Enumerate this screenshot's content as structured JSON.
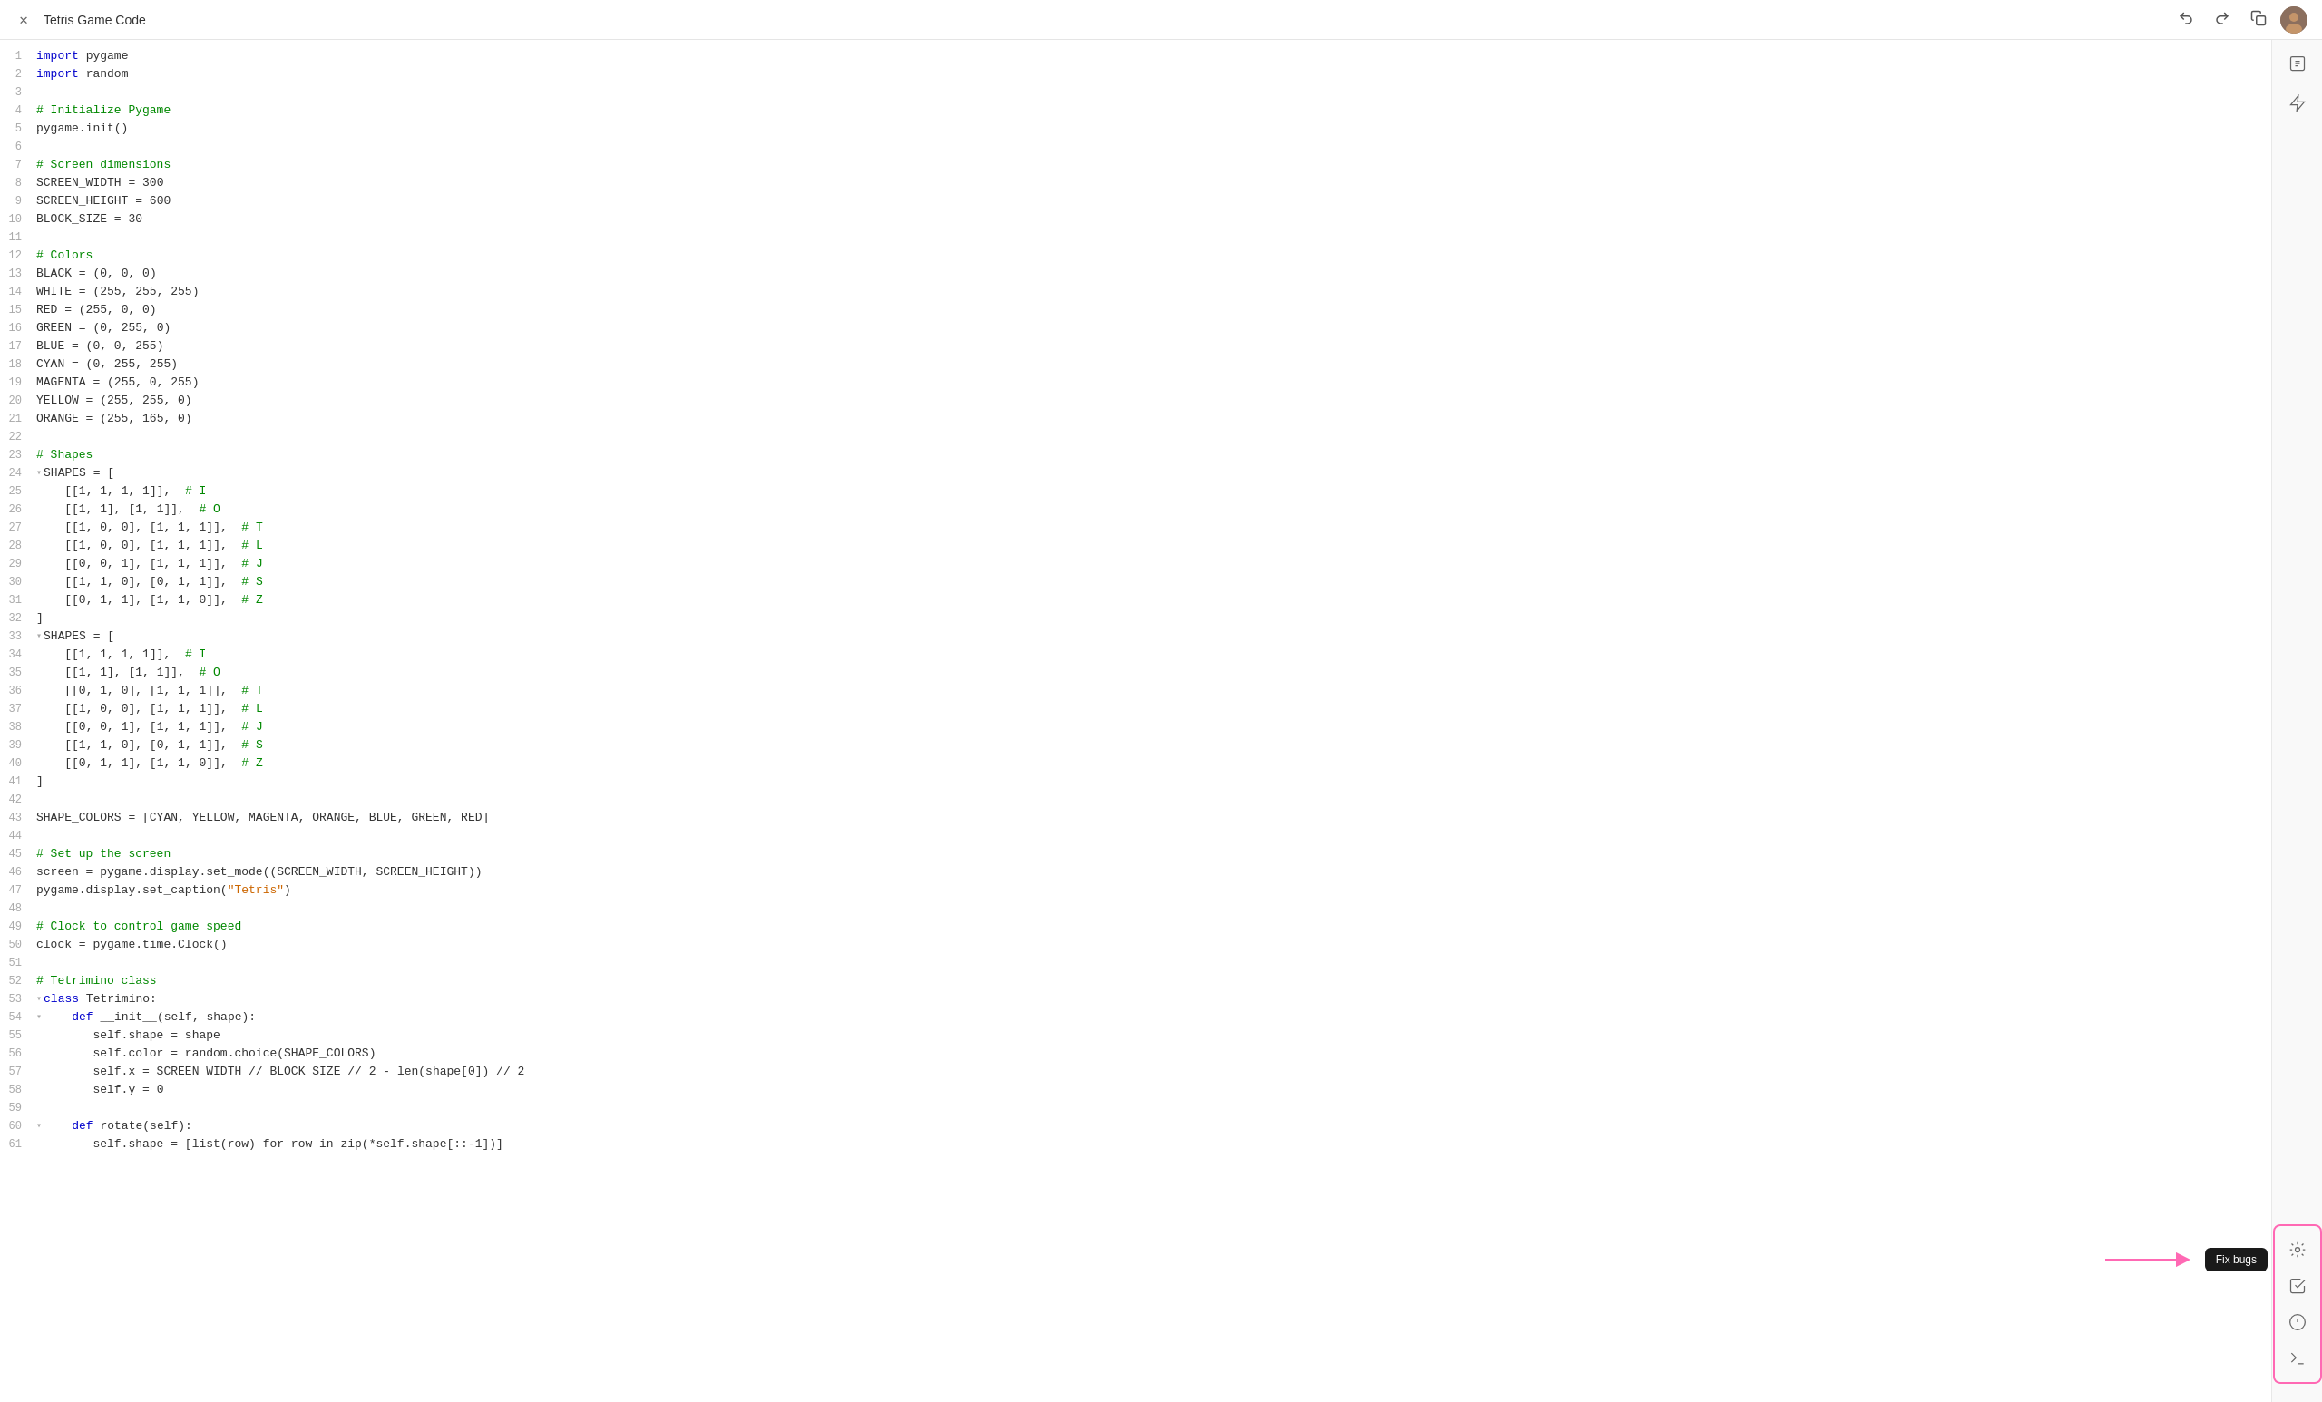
{
  "titleBar": {
    "title": "Tetris Game Code",
    "closeLabel": "×",
    "undoLabel": "↩",
    "redoLabel": "↪",
    "copyLabel": "⧉"
  },
  "toolbar": {
    "fixBugsLabel": "Fix bugs"
  },
  "code": {
    "lines": [
      {
        "num": 1,
        "text": "import pygame",
        "fold": false
      },
      {
        "num": 2,
        "text": "import random",
        "fold": false
      },
      {
        "num": 3,
        "text": "",
        "fold": false
      },
      {
        "num": 4,
        "text": "# Initialize Pygame",
        "fold": false
      },
      {
        "num": 5,
        "text": "pygame.init()",
        "fold": false
      },
      {
        "num": 6,
        "text": "",
        "fold": false
      },
      {
        "num": 7,
        "text": "# Screen dimensions",
        "fold": false
      },
      {
        "num": 8,
        "text": "SCREEN_WIDTH = 300",
        "fold": false
      },
      {
        "num": 9,
        "text": "SCREEN_HEIGHT = 600",
        "fold": false
      },
      {
        "num": 10,
        "text": "BLOCK_SIZE = 30",
        "fold": false
      },
      {
        "num": 11,
        "text": "",
        "fold": false
      },
      {
        "num": 12,
        "text": "# Colors",
        "fold": false
      },
      {
        "num": 13,
        "text": "BLACK = (0, 0, 0)",
        "fold": false
      },
      {
        "num": 14,
        "text": "WHITE = (255, 255, 255)",
        "fold": false
      },
      {
        "num": 15,
        "text": "RED = (255, 0, 0)",
        "fold": false
      },
      {
        "num": 16,
        "text": "GREEN = (0, 255, 0)",
        "fold": false
      },
      {
        "num": 17,
        "text": "BLUE = (0, 0, 255)",
        "fold": false
      },
      {
        "num": 18,
        "text": "CYAN = (0, 255, 255)",
        "fold": false
      },
      {
        "num": 19,
        "text": "MAGENTA = (255, 0, 255)",
        "fold": false
      },
      {
        "num": 20,
        "text": "YELLOW = (255, 255, 0)",
        "fold": false
      },
      {
        "num": 21,
        "text": "ORANGE = (255, 165, 0)",
        "fold": false
      },
      {
        "num": 22,
        "text": "",
        "fold": false
      },
      {
        "num": 23,
        "text": "# Shapes",
        "fold": false
      },
      {
        "num": 24,
        "text": "SHAPES = [",
        "fold": true
      },
      {
        "num": 25,
        "text": "    [[1, 1, 1, 1]],  # I",
        "fold": false
      },
      {
        "num": 26,
        "text": "    [[1, 1], [1, 1]],  # O",
        "fold": false
      },
      {
        "num": 27,
        "text": "    [[1, 0, 0], [1, 1, 1]],  # T",
        "fold": false
      },
      {
        "num": 28,
        "text": "    [[1, 0, 0], [1, 1, 1]],  # L",
        "fold": false
      },
      {
        "num": 29,
        "text": "    [[0, 0, 1], [1, 1, 1]],  # J",
        "fold": false
      },
      {
        "num": 30,
        "text": "    [[1, 1, 0], [0, 1, 1]],  # S",
        "fold": false
      },
      {
        "num": 31,
        "text": "    [[0, 1, 1], [1, 1, 0]],  # Z",
        "fold": false
      },
      {
        "num": 32,
        "text": "]",
        "fold": false
      },
      {
        "num": 33,
        "text": "SHAPES = [",
        "fold": true
      },
      {
        "num": 34,
        "text": "    [[1, 1, 1, 1]],  # I",
        "fold": false
      },
      {
        "num": 35,
        "text": "    [[1, 1], [1, 1]],  # O",
        "fold": false
      },
      {
        "num": 36,
        "text": "    [[0, 1, 0], [1, 1, 1]],  # T",
        "fold": false
      },
      {
        "num": 37,
        "text": "    [[1, 0, 0], [1, 1, 1]],  # L",
        "fold": false
      },
      {
        "num": 38,
        "text": "    [[0, 0, 1], [1, 1, 1]],  # J",
        "fold": false
      },
      {
        "num": 39,
        "text": "    [[1, 1, 0], [0, 1, 1]],  # S",
        "fold": false
      },
      {
        "num": 40,
        "text": "    [[0, 1, 1], [1, 1, 0]],  # Z",
        "fold": false
      },
      {
        "num": 41,
        "text": "]",
        "fold": false
      },
      {
        "num": 42,
        "text": "",
        "fold": false
      },
      {
        "num": 43,
        "text": "SHAPE_COLORS = [CYAN, YELLOW, MAGENTA, ORANGE, BLUE, GREEN, RED]",
        "fold": false
      },
      {
        "num": 44,
        "text": "",
        "fold": false
      },
      {
        "num": 45,
        "text": "# Set up the screen",
        "fold": false
      },
      {
        "num": 46,
        "text": "screen = pygame.display.set_mode((SCREEN_WIDTH, SCREEN_HEIGHT))",
        "fold": false
      },
      {
        "num": 47,
        "text": "pygame.display.set_caption(\"Tetris\")",
        "fold": false
      },
      {
        "num": 48,
        "text": "",
        "fold": false
      },
      {
        "num": 49,
        "text": "# Clock to control game speed",
        "fold": false
      },
      {
        "num": 50,
        "text": "clock = pygame.time.Clock()",
        "fold": false
      },
      {
        "num": 51,
        "text": "",
        "fold": false
      },
      {
        "num": 52,
        "text": "# Tetrimino class",
        "fold": false
      },
      {
        "num": 53,
        "text": "class Tetrimino:",
        "fold": true
      },
      {
        "num": 54,
        "text": "    def __init__(self, shape):",
        "fold": true
      },
      {
        "num": 55,
        "text": "        self.shape = shape",
        "fold": false
      },
      {
        "num": 56,
        "text": "        self.color = random.choice(SHAPE_COLORS)",
        "fold": false
      },
      {
        "num": 57,
        "text": "        self.x = SCREEN_WIDTH // BLOCK_SIZE // 2 - len(shape[0]) // 2",
        "fold": false
      },
      {
        "num": 58,
        "text": "        self.y = 0",
        "fold": false
      },
      {
        "num": 59,
        "text": "",
        "fold": false
      },
      {
        "num": 60,
        "text": "    def rotate(self):",
        "fold": true
      },
      {
        "num": 61,
        "text": "        self.shape = [list(row) for row in zip(*self.shape[::-1])]",
        "fold": false
      }
    ]
  },
  "icons": {
    "close": "✕",
    "undo": "↩",
    "redo": "↪",
    "copy": "⧉",
    "icon1": "☰",
    "icon2": "⚡",
    "icon3": "☑",
    "icon4": "⚙",
    "icon5": "⊕",
    "icon6": "◎"
  }
}
